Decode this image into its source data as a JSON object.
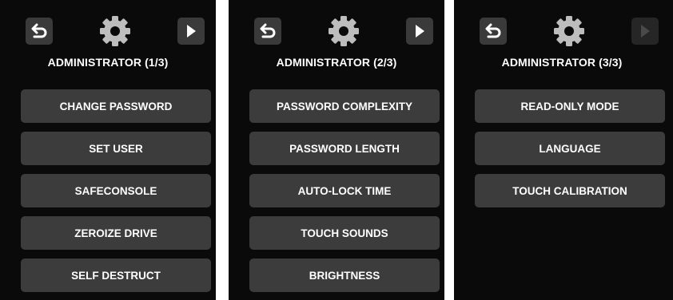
{
  "colors": {
    "screen_bg": "#0a0a0a",
    "button_bg": "#3c3c3c",
    "icon_bg": "#3a3a3a",
    "icon_fg": "#ffffff",
    "gear": "#bdbdbd"
  },
  "icons": {
    "back": "back-arrow-icon",
    "settings": "gear-icon",
    "next": "play-next-icon"
  },
  "screens": [
    {
      "title": "ADMINISTRATOR (1/3)",
      "next_enabled": true,
      "buttons": [
        "CHANGE PASSWORD",
        "SET USER",
        "SAFECONSOLE",
        "ZEROIZE DRIVE",
        "SELF DESTRUCT"
      ]
    },
    {
      "title": "ADMINISTRATOR (2/3)",
      "next_enabled": true,
      "buttons": [
        "PASSWORD COMPLEXITY",
        "PASSWORD LENGTH",
        "AUTO-LOCK TIME",
        "TOUCH SOUNDS",
        "BRIGHTNESS"
      ]
    },
    {
      "title": "ADMINISTRATOR (3/3)",
      "next_enabled": false,
      "buttons": [
        "READ-ONLY MODE",
        "LANGUAGE",
        "TOUCH CALIBRATION"
      ]
    }
  ]
}
